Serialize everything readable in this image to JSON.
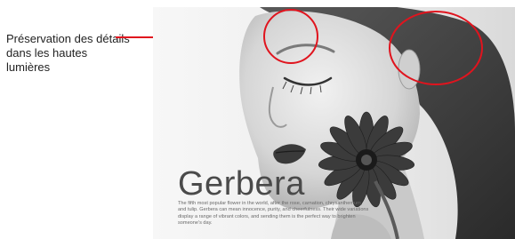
{
  "callout": {
    "label": "Préservation des détails dans les hautes lumières"
  },
  "card": {
    "headline": "Gerbera",
    "body": "The fifth most popular flower in the world, after the rose, carnation, chrysanthemum, and tulip. Gerbera can mean innocence, purity, and cheerfulness. Their wide variations display a range of vibrant colors, and sending them is the perfect way to brighten someone's day."
  },
  "colors": {
    "accent": "#e0141e",
    "background": "#ffffff",
    "photo_tone": "grayscale"
  }
}
